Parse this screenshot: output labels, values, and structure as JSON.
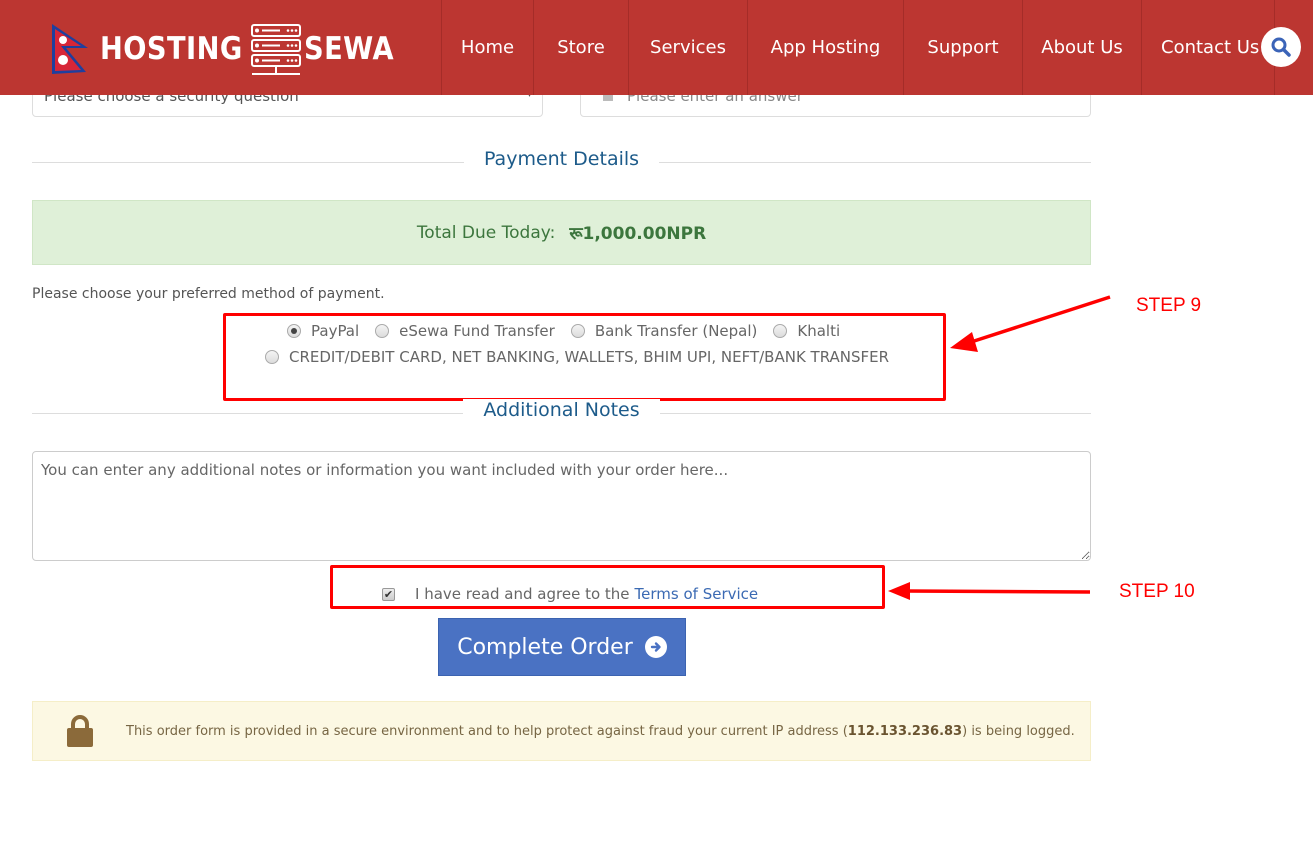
{
  "brand": {
    "name_part1": "HOSTING",
    "name_part2": "SEWA",
    "bar_color": "#bc3631"
  },
  "nav": {
    "items": [
      {
        "label": "Home"
      },
      {
        "label": "Store"
      },
      {
        "label": "Services"
      },
      {
        "label": "App Hosting"
      },
      {
        "label": "Support"
      },
      {
        "label": "About Us"
      },
      {
        "label": "Contact Us"
      }
    ],
    "search_icon": "search-icon"
  },
  "security": {
    "question_placeholder": "Please choose a security question",
    "answer_placeholder": "Please enter an answer"
  },
  "payment": {
    "section_title": "Payment Details",
    "total_label": "Total Due Today:",
    "total_amount": "रू1,000.00NPR",
    "prompt": "Please choose your preferred method of payment.",
    "methods": [
      {
        "label": "PayPal",
        "checked": true
      },
      {
        "label": "eSewa Fund Transfer",
        "checked": false
      },
      {
        "label": "Bank Transfer (Nepal)",
        "checked": false
      },
      {
        "label": "Khalti",
        "checked": false
      },
      {
        "label": "CREDIT/DEBIT CARD, NET BANKING, WALLETS, BHIM UPI, NEFT/BANK TRANSFER",
        "checked": false
      }
    ]
  },
  "notes": {
    "section_title": "Additional Notes",
    "placeholder": "You can enter any additional notes or information you want included with your order here..."
  },
  "terms": {
    "text": "I have read and agree to the",
    "link": "Terms of Service",
    "checked": true
  },
  "complete_button": "Complete Order",
  "secure_notice": {
    "before": "This order form is provided in a secure environment and to help protect against fraud your current IP address (",
    "ip": "112.133.236.83",
    "after": ") is being logged."
  },
  "annotations": {
    "step9": "STEP 9",
    "step10": "STEP 10",
    "color": "#ff0000"
  }
}
